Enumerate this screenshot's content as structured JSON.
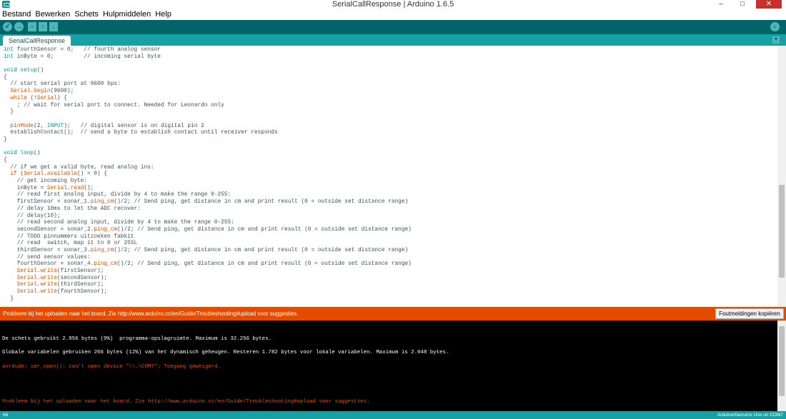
{
  "window": {
    "title": "SerialCallResponse | Arduino 1.6.5",
    "minimize": "–",
    "maximize": "□",
    "close": "✕"
  },
  "menu": [
    "Bestand",
    "Bewerken",
    "Schets",
    "Hulpmiddelen",
    "Help"
  ],
  "toolbar": {
    "verify_icon": "✓",
    "upload_icon": "→",
    "new_icon": "▫",
    "open_icon": "↑",
    "save_icon": "↓",
    "serial_monitor_icon": "⌕"
  },
  "tabs": [
    {
      "label": "SerialCallResponse"
    }
  ],
  "tab_menu_icon": "▼",
  "editor": {
    "lines": [
      [
        {
          "t": "int",
          "c": "kw"
        },
        {
          "t": " fourthSensor = 0;   // fourth analog sensor"
        }
      ],
      [
        {
          "t": "int",
          "c": "kw"
        },
        {
          "t": " inByte = 0;         // incoming serial byte"
        }
      ],
      [
        {
          "t": ""
        }
      ],
      [
        {
          "t": "void",
          "c": "kw"
        },
        {
          "t": " "
        },
        {
          "t": "setup",
          "c": "kw"
        },
        {
          "t": "()"
        }
      ],
      [
        {
          "t": "{"
        }
      ],
      [
        {
          "t": "  // start serial port at 9600 bps:"
        }
      ],
      [
        {
          "t": "  "
        },
        {
          "t": "Serial",
          "c": "fn"
        },
        {
          "t": "."
        },
        {
          "t": "begin",
          "c": "fn"
        },
        {
          "t": "(9600);"
        }
      ],
      [
        {
          "t": "  "
        },
        {
          "t": "while",
          "c": "fn"
        },
        {
          "t": " (!"
        },
        {
          "t": "Serial",
          "c": "fn"
        },
        {
          "t": ") {"
        }
      ],
      [
        {
          "t": "    ; // wait for serial port to connect. Needed for Leonardo only"
        }
      ],
      [
        {
          "t": "  }"
        }
      ],
      [
        {
          "t": ""
        }
      ],
      [
        {
          "t": "  "
        },
        {
          "t": "pinMode",
          "c": "fn"
        },
        {
          "t": "(2, "
        },
        {
          "t": "INPUT",
          "c": "kw"
        },
        {
          "t": ");   // digital sensor is on digital pin 2"
        }
      ],
      [
        {
          "t": "  establishContact();  // send a byte to establish contact until receiver responds"
        }
      ],
      [
        {
          "t": "}"
        }
      ],
      [
        {
          "t": ""
        }
      ],
      [
        {
          "t": "void",
          "c": "kw"
        },
        {
          "t": " "
        },
        {
          "t": "loop",
          "c": "kw"
        },
        {
          "t": "()"
        }
      ],
      [
        {
          "t": "{"
        }
      ],
      [
        {
          "t": "  // if we get a valid byte, read analog ins:"
        }
      ],
      [
        {
          "t": "  "
        },
        {
          "t": "if",
          "c": "fn"
        },
        {
          "t": " ("
        },
        {
          "t": "Serial",
          "c": "fn"
        },
        {
          "t": "."
        },
        {
          "t": "available",
          "c": "fn"
        },
        {
          "t": "() > 0) {"
        }
      ],
      [
        {
          "t": "    // get incoming byte:"
        }
      ],
      [
        {
          "t": "    inByte = "
        },
        {
          "t": "Serial",
          "c": "fn"
        },
        {
          "t": "."
        },
        {
          "t": "read",
          "c": "fn"
        },
        {
          "t": "();"
        }
      ],
      [
        {
          "t": "    // read first analog input, divide by 4 to make the range 0-255:"
        }
      ],
      [
        {
          "t": "    firstSensor = sonar_1."
        },
        {
          "t": "ping_cm",
          "c": "fn"
        },
        {
          "t": "()/2; // Send ping, get distance in cm and print result (0 = outside set distance range)"
        }
      ],
      [
        {
          "t": "    // delay 10ms to let the ADC recover:"
        }
      ],
      [
        {
          "t": "    // delay(10);"
        }
      ],
      [
        {
          "t": "    // read second analog input, divide by 4 to make the range 0-255:"
        }
      ],
      [
        {
          "t": "    secondSensor = sonar_2."
        },
        {
          "t": "ping_cm",
          "c": "fn"
        },
        {
          "t": "()/2; // Send ping, get distance in cm and print result (0 = outside set distance range)"
        }
      ],
      [
        {
          "t": "    // TODO pinnummers uitzoeken fabkit"
        }
      ],
      [
        {
          "t": "    // read  switch, map it to 0 or 255L"
        }
      ],
      [
        {
          "t": "    thirdSensor = sonar_3."
        },
        {
          "t": "ping_cm",
          "c": "fn"
        },
        {
          "t": "()/2; // Send ping, get distance in cm and print result (0 = outside set distance range)"
        }
      ],
      [
        {
          "t": "    // send sensor values:"
        }
      ],
      [
        {
          "t": "    fourthSensor = sonar_4."
        },
        {
          "t": "ping_cm",
          "c": "fn"
        },
        {
          "t": "()/2; // Send ping, get distance in cm and print result (0 = outside set distance range)"
        }
      ],
      [
        {
          "t": "    "
        },
        {
          "t": "Serial",
          "c": "fn"
        },
        {
          "t": "."
        },
        {
          "t": "write",
          "c": "fn"
        },
        {
          "t": "(firstSensor);"
        }
      ],
      [
        {
          "t": "    "
        },
        {
          "t": "Serial",
          "c": "fn"
        },
        {
          "t": "."
        },
        {
          "t": "write",
          "c": "fn"
        },
        {
          "t": "(secondSensor);"
        }
      ],
      [
        {
          "t": "    "
        },
        {
          "t": "Serial",
          "c": "fn"
        },
        {
          "t": "."
        },
        {
          "t": "write",
          "c": "fn"
        },
        {
          "t": "(thirdSensor);"
        }
      ],
      [
        {
          "t": "    "
        },
        {
          "t": "Serial",
          "c": "fn"
        },
        {
          "t": "."
        },
        {
          "t": "write",
          "c": "fn"
        },
        {
          "t": "(fourthSensor);"
        }
      ],
      [
        {
          "t": "  }"
        }
      ]
    ]
  },
  "message_bar": {
    "text": "Probleem bij het uploaden naar het board. Zie http://www.arduino.cc/en/Guide/Troubleshooting#upload voor suggesties.",
    "copy_button": "Foutmeldingen kopiëren",
    "color": "#e34c00"
  },
  "console": {
    "lines": [
      {
        "text": "De schets gebruikt 2.956 bytes (9%)  programma-opslagruimte. Maximum is 32.256 bytes.",
        "color": "#ffffff"
      },
      {
        "text": "Globale variabelen gebruiken 266 bytes (12%) van het dynamisch geheugen. Resteren 1.782 bytes voor lokale variabelen. Maximum is 2.048 bytes.",
        "color": "#ffffff"
      },
      {
        "text": "avrdude: ser_open(): can't open device \"\\\\.\\COM7\": Toegang geweigerd.",
        "color": "#e34c00"
      },
      {
        "text": "Probleem bij het uploaden naar het board. Zie http://www.arduino.cc/en/Guide/Troubleshooting#upload voor suggesties.",
        "color": "#e34c00"
      }
    ]
  },
  "status": {
    "line_number": "66",
    "board": "Arduino/Genuino Uno on COM7"
  },
  "colors": {
    "toolbar": "#006468",
    "tabbar": "#17a1a5",
    "accent": "#00979c",
    "error": "#e34c00"
  }
}
